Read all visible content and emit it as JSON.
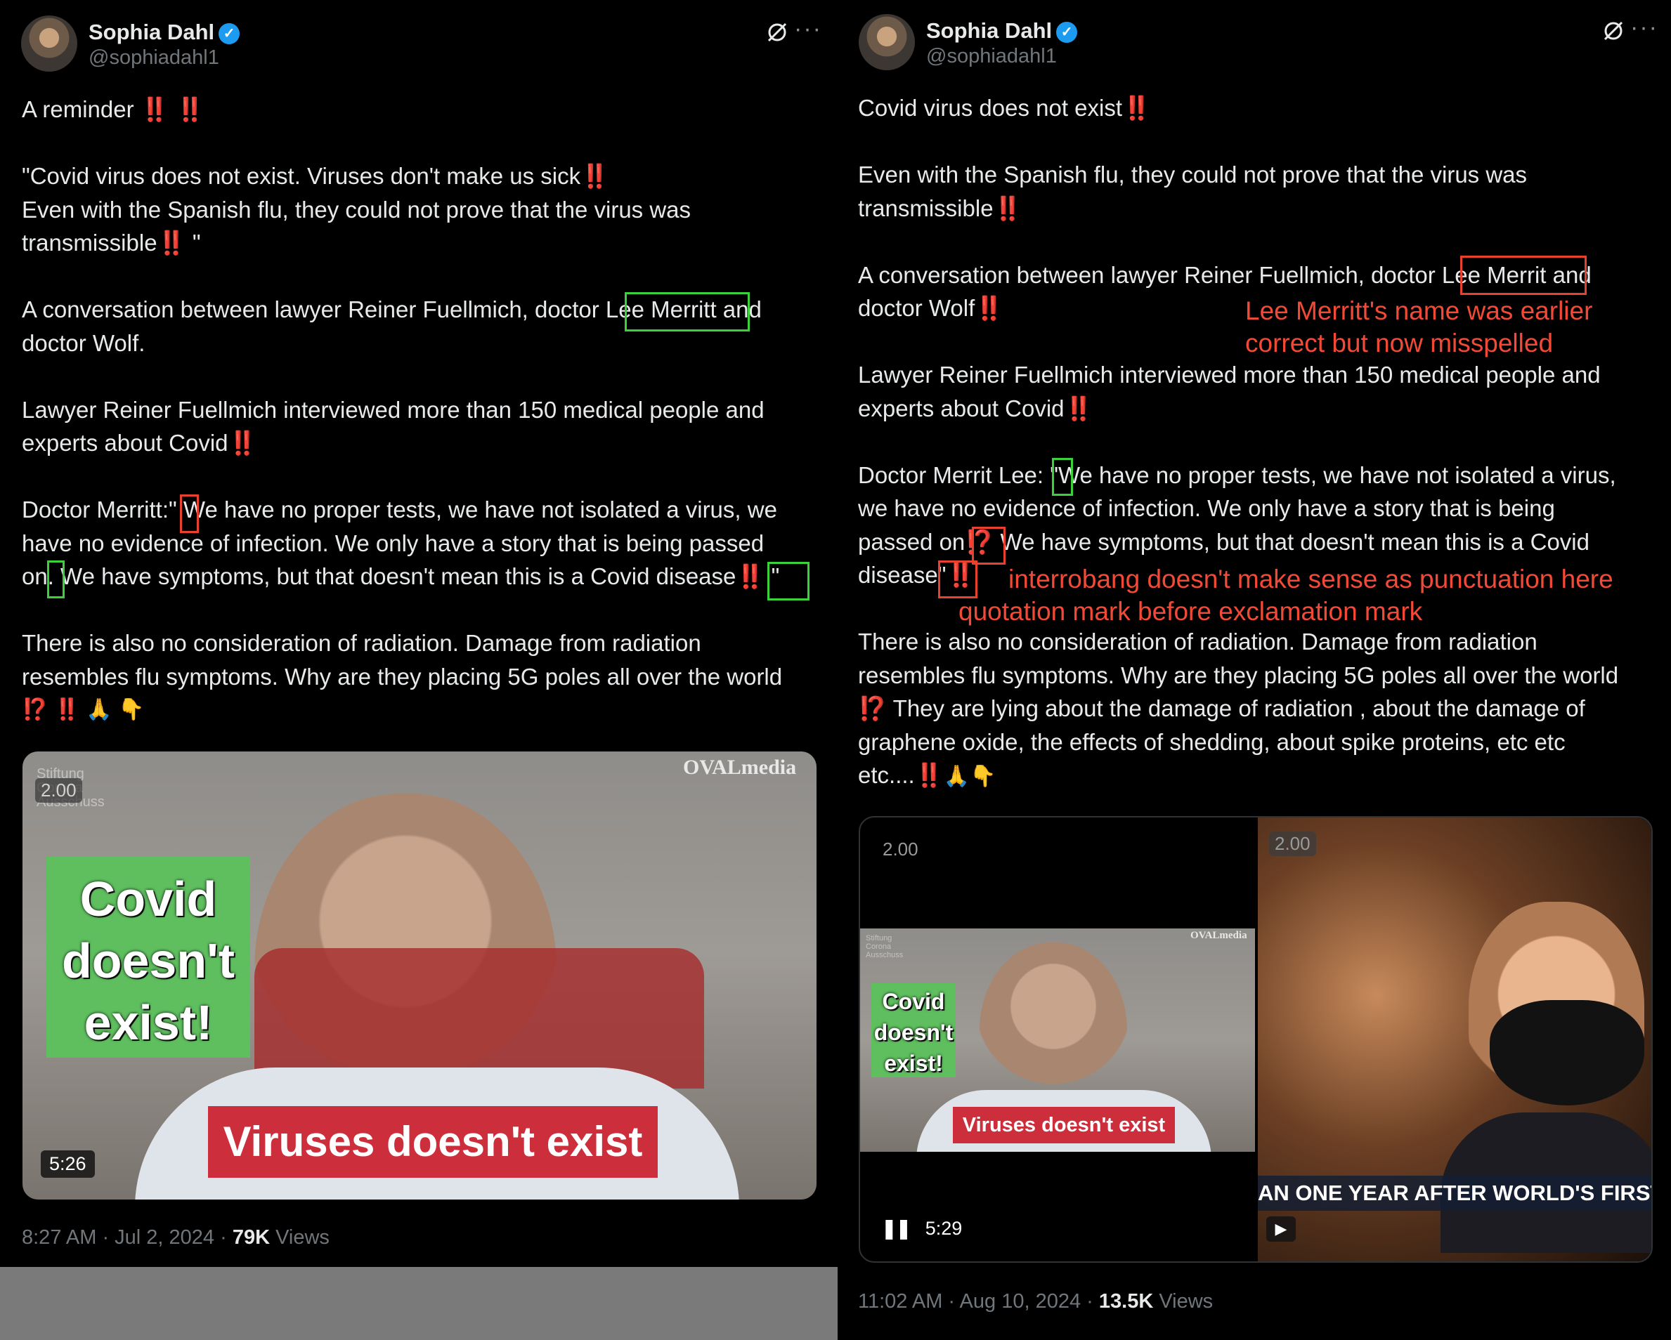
{
  "left": {
    "author": {
      "name": "Sophia Dahl",
      "handle": "@sophiadahl1"
    },
    "icons": {
      "grok": "grok-icon",
      "more": "more-icon",
      "verified": "verified-badge-icon"
    },
    "text": {
      "l1": "A reminder",
      "l1_marks": "‼️ ‼️",
      "l2": "\"Covid virus does not exist. Viruses don't make us sick",
      "l3": "Even with the Spanish flu, they could not prove that the virus was",
      "l4": "transmissible",
      "l4_tail": "\"",
      "l5a": "A conversation between lawyer Reiner Fuellmich, doctor ",
      "l5name": "Lee Merritt",
      "l5b": " and",
      "l6": "doctor Wolf.",
      "l7": "Lawyer Reiner Fuellmich interviewed more than 150 medical people and",
      "l8": "experts about Covid",
      "l9a": "Doctor Merritt:",
      "l9b": "\" We have no proper tests, we have not isolated a virus, we",
      "l10": "have no evidence of infection. We only have a story that is being passed",
      "l11a": "on.",
      "l11b": " We have symptoms, but that doesn't mean this is a Covid disease",
      "l11tail": "\"",
      "l12": "There is also no consideration of radiation. Damage from radiation",
      "l13": "resembles flu symptoms. Why are they placing 5G poles all over the world",
      "l14": "⁉️ ‼️ 🙏 👇"
    },
    "video": {
      "speed": "2.00",
      "watermark": "OVALmedia",
      "stiftung": "Stiftung Corona Ausschuss",
      "card": "Covid doesn't exist!",
      "banner": "Viruses doesn't exist",
      "duration": "5:26"
    },
    "meta": {
      "time": "8:27 AM · Jul 2, 2024 · ",
      "views_count": "79K",
      "views_label": " Views"
    }
  },
  "right": {
    "author": {
      "name": "Sophia Dahl",
      "handle": "@sophiadahl1"
    },
    "text": {
      "l1": "Covid virus does not exist",
      "l2": "Even with the Spanish flu, they could not prove that the virus was",
      "l3": "transmissible",
      "l4a": "A conversation between lawyer Reiner Fuellmich, doctor ",
      "l4name": "Lee Merrit",
      "l4b": " and",
      "l5": "doctor Wolf",
      "l6": "Lawyer Reiner Fuellmich interviewed more than 150 medical people and",
      "l7": "experts about Covid",
      "l8a": "Doctor Merrit Lee: ",
      "l8q": "\"",
      "l8b": "We have no proper tests, we have not isolated a virus,",
      "l9": "we have no evidence of infection. We only have a story that is being",
      "l10a": "passed on",
      "l10b": " We have symptoms, but that doesn't mean this is a Covid",
      "l11a": "disease\"",
      "l12": "There is also no consideration of radiation. Damage from radiation",
      "l13": "resembles flu symptoms. Why are they placing 5G poles all over the world",
      "l14": " They are lying about the damage of radiation , about the damage of",
      "l15": "graphene oxide, the effects of shedding, about spike proteins, etc etc",
      "l16": "etc...."
    },
    "annotations": {
      "name_note_1": "Lee Merritt's name was earlier",
      "name_note_2": "correct but now misspelled",
      "interrobang_note": "interrobang doesn't make sense as punctuation here",
      "quote_note": "quotation mark before exclamation mark"
    },
    "video": {
      "speed_left": "2.00",
      "speed_right": "2.00",
      "watermark": "OVALmedia",
      "stiftung": "Stiftung Corona Ausschuss",
      "card": "Covid doesn't exist!",
      "banner": "Viruses doesn't exist",
      "ticker": "AN ONE YEAR AFTER WORLD'S FIRST COVID LOCK",
      "duration": "5:29"
    },
    "meta": {
      "time": "11:02 AM · Aug 10, 2024 · ",
      "views_count": "13.5K",
      "views_label": " Views"
    }
  },
  "colors": {
    "annotation_red": "#e8412f",
    "annotation_green": "#3ad13a",
    "background": "#000000",
    "verified": "#1d9bf0"
  }
}
